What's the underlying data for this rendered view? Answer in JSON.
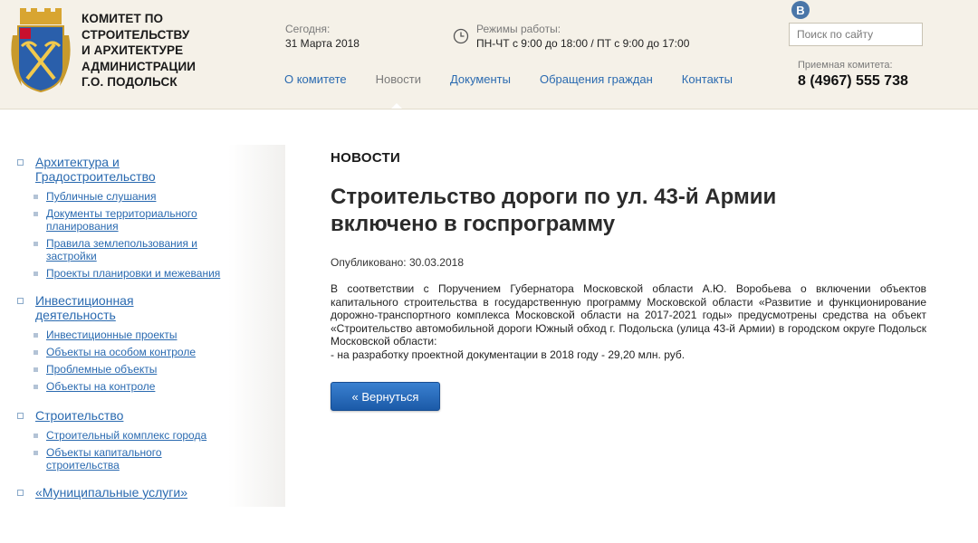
{
  "header": {
    "org_name": [
      "КОМИТЕТ ПО",
      "СТРОИТЕЛЬСТВУ",
      "И АРХИТЕКТУРЕ",
      "АДМИНИСТРАЦИИ",
      "Г.О. ПОДОЛЬСК"
    ],
    "today_label": "Сегодня:",
    "today_value": "31 Марта 2018",
    "hours_label": "Режимы работы:",
    "hours_value": "ПН-ЧТ с 9:00 до 18:00 / ПТ с 9:00 до 17:00",
    "social": "B",
    "search_placeholder": "Поиск по сайту",
    "reception_label": "Приемная комитета:",
    "reception_phone": "8 (4967) 555 738",
    "nav": [
      {
        "label": "О комитете",
        "active": false
      },
      {
        "label": "Новости",
        "active": true
      },
      {
        "label": "Документы",
        "active": false
      },
      {
        "label": "Обращения граждан",
        "active": false
      },
      {
        "label": "Контакты",
        "active": false
      }
    ]
  },
  "sidebar": [
    {
      "title": [
        "Архитектура и",
        "Градостроительство"
      ],
      "items": [
        [
          "Публичные слушания"
        ],
        [
          "Документы территориального",
          "планирования"
        ],
        [
          "Правила землепользования и",
          "застройки"
        ],
        [
          "Проекты планировки и межевания"
        ]
      ]
    },
    {
      "title": [
        "Инвестиционная",
        "деятельность"
      ],
      "items": [
        [
          "Инвестиционные проекты"
        ],
        [
          "Объекты на особом контроле"
        ],
        [
          "Проблемные объекты"
        ],
        [
          "Объекты на контроле"
        ]
      ]
    },
    {
      "title": [
        "Строительство"
      ],
      "items": [
        [
          "Строительный комплекс города"
        ],
        [
          "Объекты капитального",
          "строительства"
        ]
      ]
    },
    {
      "title": [
        "«Муниципальные услуги»"
      ],
      "items": []
    }
  ],
  "main": {
    "section_heading": "НОВОСТИ",
    "title": [
      "Строительство дороги по ул. 43-й Армии",
      "включено в госпрограмму"
    ],
    "published": "Опубликовано: 30.03.2018",
    "body": [
      "В соответствии с Поручением Губернатора Московской области А.Ю. Воробьева о включении объектов капитального строительства в государственную программу Московской области «Развитие и функционирование дорожно-транспортного комплекса Московской области на 2017-2021 годы» предусмотрены средства на объект «Строительство автомобильной дороги Южный обход г. Подольска (улица 43-й Армии) в городском округе Подольск Московской области:",
      "- на разработку проектной документации в 2018 году - 29,20 млн. руб."
    ],
    "back_button": "« Вернуться"
  }
}
